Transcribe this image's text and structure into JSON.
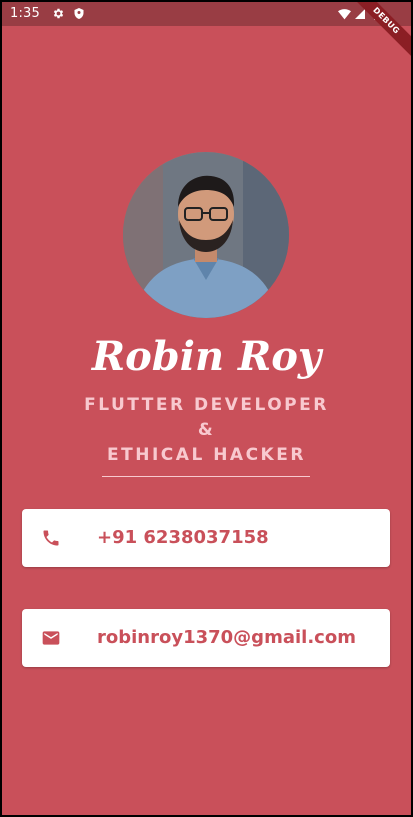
{
  "status_bar": {
    "time": "1:35"
  },
  "debug_banner": {
    "label": "DEBUG"
  },
  "profile": {
    "name": "Robin Roy",
    "title_line1": "FLUTTER DEVELOPER",
    "title_line2": "&",
    "title_line3": "ETHICAL HACKER"
  },
  "contacts": {
    "phone": "+91 6238037158",
    "email": "robinroy1370@gmail.com"
  },
  "colors": {
    "background": "#C9505A",
    "status_bar": "#993D44",
    "accent_text": "#F8C9CF",
    "card": "#FFFFFF"
  },
  "icons": {
    "status": [
      "gear-icon",
      "shield-icon",
      "wifi-icon",
      "signal-icon",
      "battery-icon"
    ],
    "contacts": [
      "phone-icon",
      "mail-icon"
    ]
  }
}
